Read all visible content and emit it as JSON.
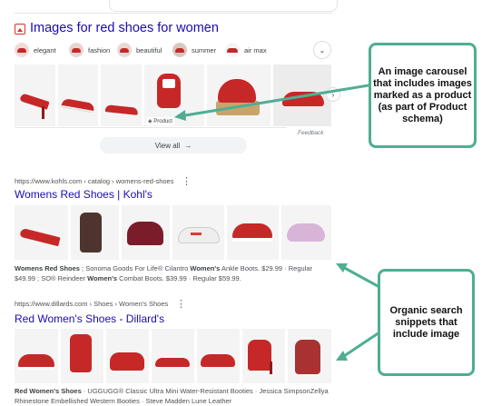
{
  "images_section": {
    "title": "Images for red shoes for women",
    "menu_icon": "kebab-icon",
    "chips": [
      {
        "label": "elegant"
      },
      {
        "label": "fashion"
      },
      {
        "label": "beautiful"
      },
      {
        "label": "summer"
      },
      {
        "label": "air max"
      }
    ],
    "product_badge": "Product",
    "feedback": "Feedback",
    "view_all": "View all"
  },
  "results": [
    {
      "url": "https://www.kohls.com › catalog › womens-red-shoes",
      "title": "Womens Red Shoes | Kohl's",
      "snippet_line1_bold": "Womens Red Shoes",
      "snippet_line1_rest": " ; Sonoma Goods For Life® Cilantro ",
      "snippet_line1_bold2": "Women's",
      "snippet_line1_rest2": " Ankle Boots. $29.99 · Regular",
      "snippet_line2_a": "$49.99 ; SO® Reindeer ",
      "snippet_line2_bold": "Women's",
      "snippet_line2_b": " Combat Boots. $39.99 · Regular $59.99."
    },
    {
      "url": "https://www.dillards.com › Shoes › Women's Shoes",
      "title": "Red Women's Shoes - Dillard's",
      "snippet_line1_bold": "Red Women's Shoes",
      "snippet_line1_rest": " · UGGUGG® Classic Ultra Mini Water-Resistant Booties · Jessica SimpsonZellya",
      "snippet_line2": "Rhinestone Embellished Western Booties · Steve Madden Lune Leather"
    }
  ],
  "callouts": {
    "carousel": "An image carousel that includes images marked as a product (as part of Product schema)",
    "organic": "Organic search snippets that include image"
  },
  "colors": {
    "link": "#1a0dab",
    "accent": "#4fae92",
    "shoe_red": "#c62828"
  }
}
